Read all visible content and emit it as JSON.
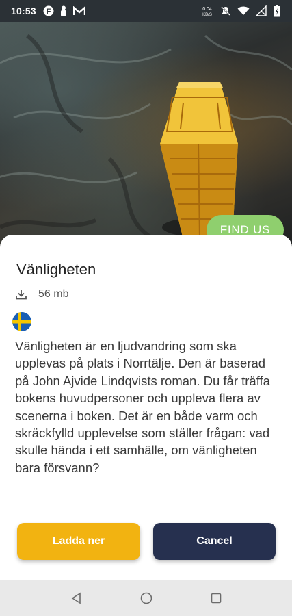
{
  "status_bar": {
    "time": "10:53",
    "left_icons": [
      "f-icon",
      "notification-person-icon",
      "m-app-icon"
    ],
    "right_icons": [
      "data-speed-icon",
      "mute-icon",
      "wifi-icon",
      "no-signal-icon",
      "battery-icon"
    ],
    "data_speed": "0.04 KB/S"
  },
  "hero": {
    "find_us_label": "FIND US",
    "find_us_color": "#8fcf6e"
  },
  "sheet": {
    "title": "Vänligheten",
    "size": "56 mb",
    "language_flag": "sweden-flag-icon",
    "description": "Vänligheten är en ljudvandring som ska upplevas på plats i Norrtälje. Den är baserad på John Ajvide Lindqvists roman. Du får träffa bokens huvudpersoner och uppleva flera av scenerna i boken. Det är en både varm och skräckfylld upplevelse som ställer frågan: vad skulle hända i ett samhälle, om vänligheten bara försvann?",
    "download_label": "Ladda ner",
    "cancel_label": "Cancel",
    "download_color": "#f2b311",
    "cancel_color": "#26304f"
  },
  "nav_bar": {
    "buttons": [
      "back-icon",
      "home-icon",
      "recents-icon"
    ]
  }
}
